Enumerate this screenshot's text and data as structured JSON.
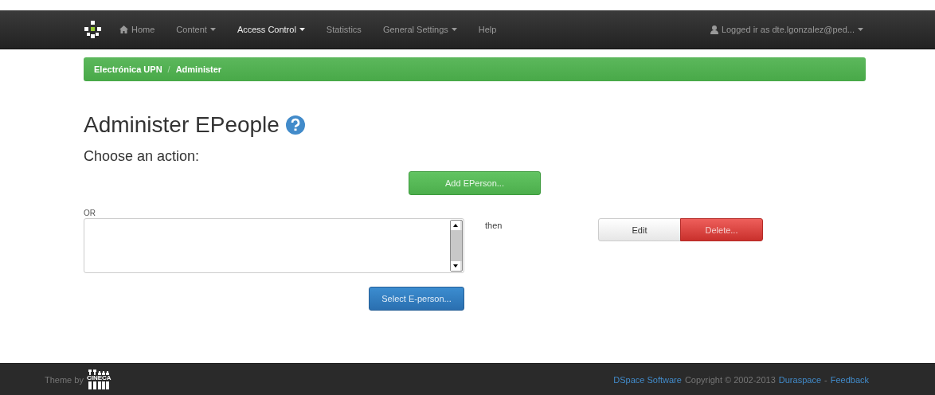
{
  "navbar": {
    "items": [
      {
        "label": "Home",
        "kind": "home",
        "selected": false,
        "dropdown": false
      },
      {
        "label": "Content",
        "kind": "menu",
        "selected": false,
        "dropdown": true
      },
      {
        "label": "Access Control",
        "kind": "menu",
        "selected": true,
        "dropdown": true
      },
      {
        "label": "Statistics",
        "kind": "menu",
        "selected": false,
        "dropdown": false
      },
      {
        "label": "General Settings",
        "kind": "menu",
        "selected": false,
        "dropdown": true
      },
      {
        "label": "Help",
        "kind": "menu",
        "selected": false,
        "dropdown": false
      }
    ],
    "user": "Logged ir as dte.lgonzalez@ped..."
  },
  "breadcrumb": {
    "items": [
      "Electrónica UPN",
      "Administer"
    ],
    "separator": "/"
  },
  "page": {
    "title": "Administer EPeople",
    "subtitle": "Choose an action:",
    "add_button": "Add EPerson...",
    "or_label": "OR",
    "then_label": "then",
    "edit_button": "Edit",
    "delete_button": "Delete...",
    "select_button": "Select E-person..."
  },
  "footer": {
    "theme_label": "Theme by",
    "logo_text": "CINECA",
    "links": [
      {
        "text": "DSpace Software",
        "kind": "link"
      },
      {
        "text": "Copyright © 2002-2013",
        "kind": "text"
      },
      {
        "text": "Duraspace",
        "kind": "link"
      },
      {
        "text": "-",
        "kind": "text"
      },
      {
        "text": "Feedback",
        "kind": "link"
      }
    ]
  }
}
